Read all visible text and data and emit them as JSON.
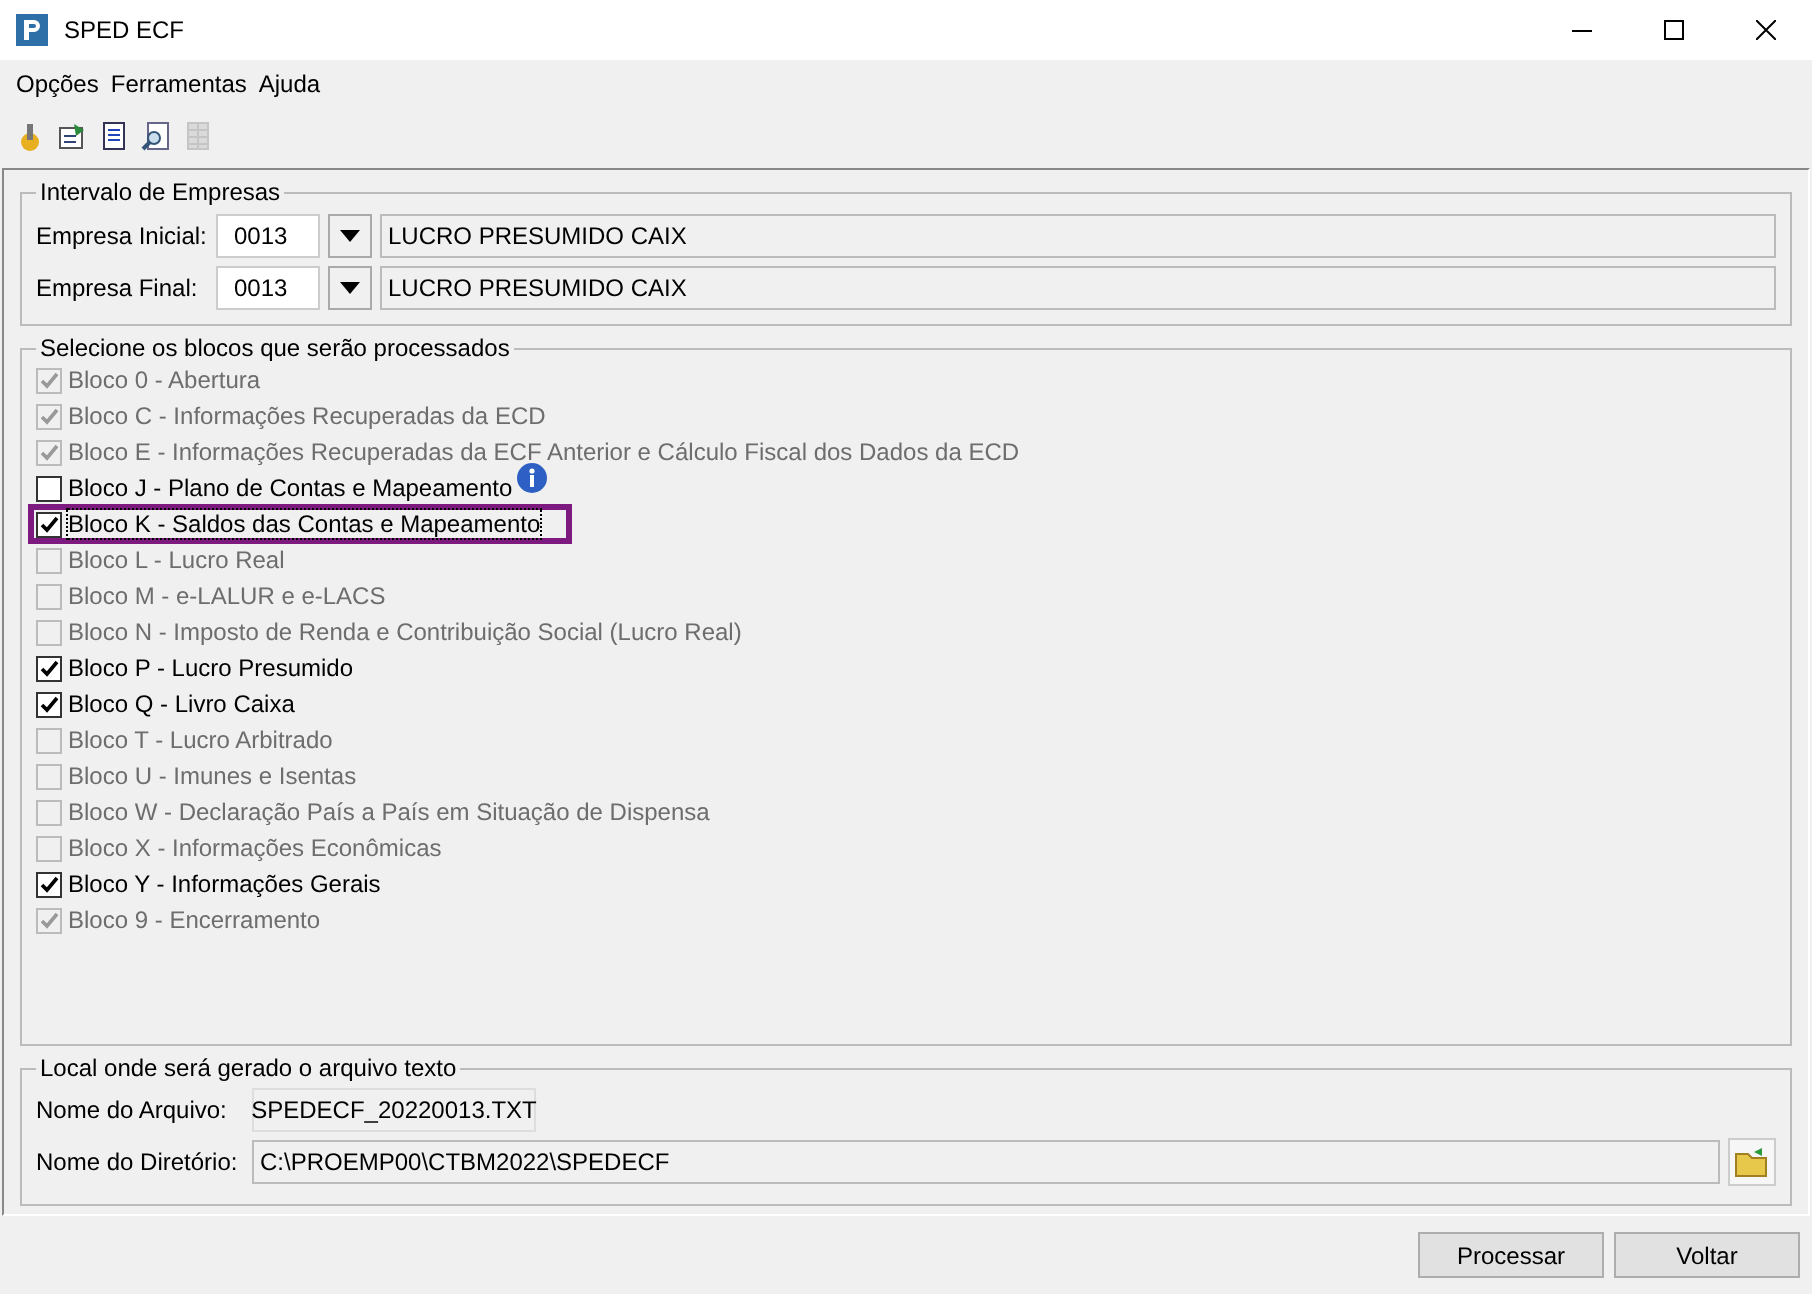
{
  "window": {
    "title": "SPED ECF"
  },
  "menu": [
    "Opções",
    "Ferramentas",
    "Ajuda"
  ],
  "toolbar": [
    {
      "kind": "wizard",
      "disabled": false
    },
    {
      "kind": "settings",
      "disabled": false
    },
    {
      "kind": "document",
      "disabled": false
    },
    {
      "kind": "preview",
      "disabled": false
    },
    {
      "kind": "grid",
      "disabled": true
    }
  ],
  "companies": {
    "title": "Intervalo de Empresas",
    "rows": [
      {
        "label": "Empresa Inicial:",
        "code": "0013",
        "name": "LUCRO PRESUMIDO CAIX"
      },
      {
        "label": "Empresa Final:",
        "code": "0013",
        "name": "LUCRO PRESUMIDO CAIX"
      }
    ]
  },
  "blocks": {
    "title": "Selecione os blocos que serão processados",
    "items": [
      {
        "label": "Bloco 0 - Abertura",
        "checked": true,
        "disabled": true,
        "highlighted": false,
        "info": false
      },
      {
        "label": "Bloco C - Informações Recuperadas da ECD",
        "checked": true,
        "disabled": true,
        "highlighted": false,
        "info": false
      },
      {
        "label": "Bloco E - Informações Recuperadas da ECF Anterior e Cálculo Fiscal dos Dados da ECD",
        "checked": true,
        "disabled": true,
        "highlighted": false,
        "info": false
      },
      {
        "label": "Bloco J - Plano de Contas e Mapeamento",
        "checked": false,
        "disabled": false,
        "highlighted": false,
        "info": true
      },
      {
        "label": "Bloco K - Saldos das Contas e Mapeamento",
        "checked": true,
        "disabled": false,
        "highlighted": true,
        "info": false
      },
      {
        "label": "Bloco L - Lucro Real",
        "checked": false,
        "disabled": true,
        "highlighted": false,
        "info": false
      },
      {
        "label": "Bloco M - e-LALUR e e-LACS",
        "checked": false,
        "disabled": true,
        "highlighted": false,
        "info": false
      },
      {
        "label": "Bloco N - Imposto de Renda e Contribuição Social (Lucro Real)",
        "checked": false,
        "disabled": true,
        "highlighted": false,
        "info": false
      },
      {
        "label": "Bloco P - Lucro Presumido",
        "checked": true,
        "disabled": false,
        "highlighted": false,
        "info": false
      },
      {
        "label": "Bloco Q - Livro Caixa",
        "checked": true,
        "disabled": false,
        "highlighted": false,
        "info": false
      },
      {
        "label": "Bloco T - Lucro Arbitrado",
        "checked": false,
        "disabled": true,
        "highlighted": false,
        "info": false
      },
      {
        "label": "Bloco U - Imunes e Isentas",
        "checked": false,
        "disabled": true,
        "highlighted": false,
        "info": false
      },
      {
        "label": "Bloco W - Declaração País a País em Situação de Dispensa",
        "checked": false,
        "disabled": true,
        "highlighted": false,
        "info": false
      },
      {
        "label": "Bloco X - Informações Econômicas",
        "checked": false,
        "disabled": true,
        "highlighted": false,
        "info": false
      },
      {
        "label": "Bloco Y - Informações Gerais",
        "checked": true,
        "disabled": false,
        "highlighted": false,
        "info": false
      },
      {
        "label": "Bloco 9 - Encerramento",
        "checked": true,
        "disabled": true,
        "highlighted": false,
        "info": false
      }
    ]
  },
  "output": {
    "title": "Local onde será gerado o arquivo texto",
    "file_label": "Nome do Arquivo:",
    "file_value": "SPEDECF_20220013.TXT",
    "dir_label": "Nome do Diretório:",
    "dir_value": "C:\\PROEMP00\\CTBM2022\\SPEDECF"
  },
  "buttons": [
    "Processar",
    "Voltar"
  ]
}
